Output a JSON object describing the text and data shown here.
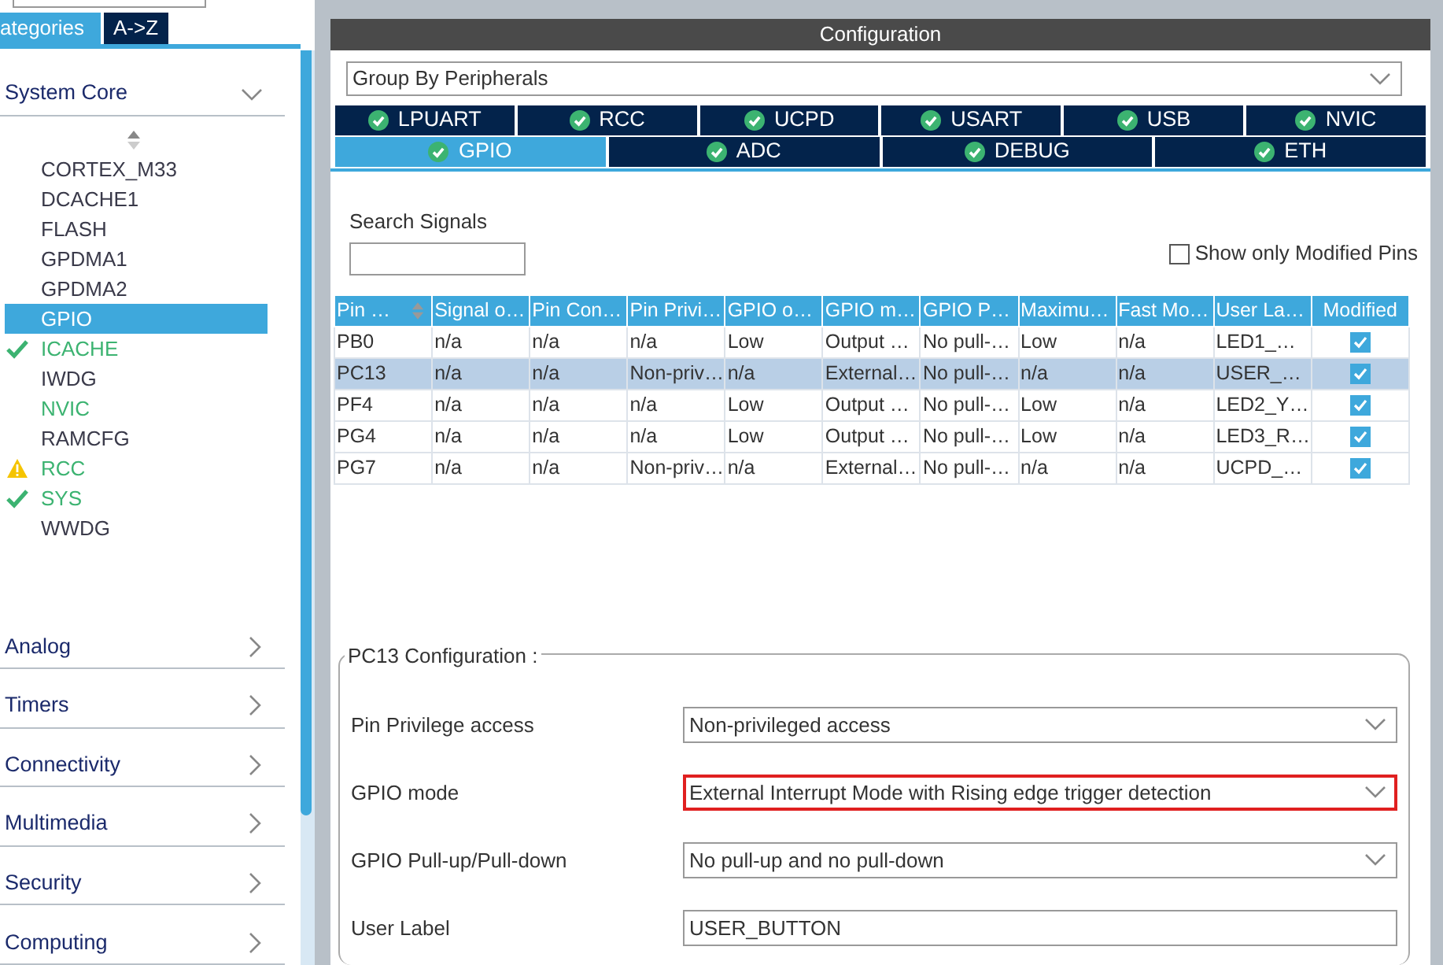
{
  "sidebar": {
    "tabs": [
      {
        "label": "ategories",
        "selected": true
      },
      {
        "label": "A->Z",
        "selected": false
      }
    ],
    "category": {
      "label": "System Core",
      "expanded": true
    },
    "items": [
      {
        "label": "CORTEX_M33",
        "selected": false,
        "configured": false,
        "ok": false,
        "warning": false
      },
      {
        "label": "DCACHE1",
        "selected": false,
        "configured": false,
        "ok": false,
        "warning": false
      },
      {
        "label": "FLASH",
        "selected": false,
        "configured": false,
        "ok": false,
        "warning": false
      },
      {
        "label": "GPDMA1",
        "selected": false,
        "configured": false,
        "ok": false,
        "warning": false
      },
      {
        "label": "GPDMA2",
        "selected": false,
        "configured": false,
        "ok": false,
        "warning": false
      },
      {
        "label": "GPIO",
        "selected": true,
        "configured": false,
        "ok": false,
        "warning": false
      },
      {
        "label": "ICACHE",
        "selected": false,
        "configured": true,
        "ok": true,
        "warning": false
      },
      {
        "label": "IWDG",
        "selected": false,
        "configured": false,
        "ok": false,
        "warning": false
      },
      {
        "label": "NVIC",
        "selected": false,
        "configured": true,
        "ok": false,
        "warning": false
      },
      {
        "label": "RAMCFG",
        "selected": false,
        "configured": false,
        "ok": false,
        "warning": false
      },
      {
        "label": "RCC",
        "selected": false,
        "configured": true,
        "ok": false,
        "warning": true
      },
      {
        "label": "SYS",
        "selected": false,
        "configured": true,
        "ok": true,
        "warning": false
      },
      {
        "label": "WWDG",
        "selected": false,
        "configured": false,
        "ok": false,
        "warning": false
      }
    ],
    "categories": [
      {
        "label": "Analog",
        "expanded": false
      },
      {
        "label": "Timers",
        "expanded": false
      },
      {
        "label": "Connectivity",
        "expanded": false
      },
      {
        "label": "Multimedia",
        "expanded": false
      },
      {
        "label": "Security",
        "expanded": false
      },
      {
        "label": "Computing",
        "expanded": false
      }
    ]
  },
  "configuration": {
    "title": "Configuration",
    "group_by": "Group By Peripherals",
    "tab_rows": [
      [
        {
          "label": "LPUART",
          "selected": false
        },
        {
          "label": "RCC",
          "selected": false
        },
        {
          "label": "UCPD",
          "selected": false
        },
        {
          "label": "USART",
          "selected": false
        },
        {
          "label": "USB",
          "selected": false
        },
        {
          "label": "NVIC",
          "selected": false
        }
      ],
      [
        {
          "label": "GPIO",
          "selected": true
        },
        {
          "label": "ADC",
          "selected": false
        },
        {
          "label": "DEBUG",
          "selected": false
        },
        {
          "label": "ETH",
          "selected": false
        }
      ]
    ],
    "search_label": "Search Signals",
    "modified_filter": {
      "label": "Show only Modified Pins",
      "checked": false
    },
    "table": {
      "columns": [
        "Pin …",
        "Signal o…",
        "Pin Con…",
        "Pin Privi…",
        "GPIO o…",
        "GPIO m…",
        "GPIO P…",
        "Maximu…",
        "Fast Mo…",
        "User La…",
        "Modified"
      ],
      "rows": [
        {
          "selected": false,
          "cells": [
            "PB0",
            "n/a",
            "n/a",
            "n/a",
            "Low",
            "Output …",
            "No pull-…",
            "Low",
            "n/a",
            "LED1_…"
          ],
          "modified": true
        },
        {
          "selected": true,
          "cells": [
            "PC13",
            "n/a",
            "n/a",
            "Non-priv…",
            "n/a",
            "External…",
            "No pull-…",
            "n/a",
            "n/a",
            "USER_…"
          ],
          "modified": true
        },
        {
          "selected": false,
          "cells": [
            "PF4",
            "n/a",
            "n/a",
            "n/a",
            "Low",
            "Output …",
            "No pull-…",
            "Low",
            "n/a",
            "LED2_Y…"
          ],
          "modified": true
        },
        {
          "selected": false,
          "cells": [
            "PG4",
            "n/a",
            "n/a",
            "n/a",
            "Low",
            "Output …",
            "No pull-…",
            "Low",
            "n/a",
            "LED3_R…"
          ],
          "modified": true
        },
        {
          "selected": false,
          "cells": [
            "PG7",
            "n/a",
            "n/a",
            "Non-priv…",
            "n/a",
            "External…",
            "No pull-…",
            "n/a",
            "n/a",
            "UCPD_…"
          ],
          "modified": true
        }
      ]
    },
    "pin_config": {
      "title": "PC13 Configuration :",
      "fields": [
        {
          "label": "Pin Privilege access",
          "kind": "select",
          "value": "Non-privileged access",
          "highlighted": false
        },
        {
          "label": "GPIO mode",
          "kind": "select",
          "value": "External Interrupt Mode with Rising edge trigger detection",
          "highlighted": true
        },
        {
          "label": "GPIO Pull-up/Pull-down",
          "kind": "select",
          "value": "No pull-up and no pull-down",
          "highlighted": false
        },
        {
          "label": "User Label",
          "kind": "text",
          "value": "USER_BUTTON",
          "highlighted": false
        }
      ]
    }
  }
}
